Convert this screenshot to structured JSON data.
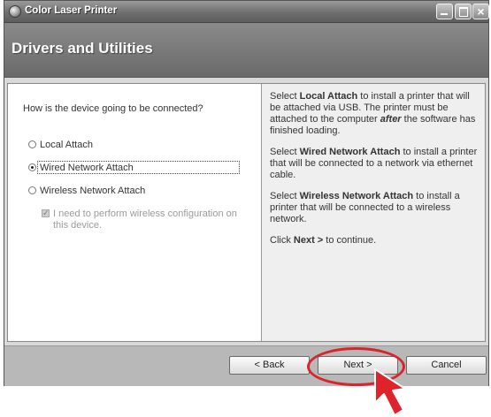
{
  "window": {
    "title": "Color Laser Printer"
  },
  "header": {
    "title": "Drivers and Utilities"
  },
  "left": {
    "question": "How is the device going to be connected?",
    "options": [
      {
        "label": "Local Attach",
        "checked": false
      },
      {
        "label": "Wired Network Attach",
        "checked": true
      },
      {
        "label": "Wireless Network Attach",
        "checked": false
      }
    ],
    "wireless_config": {
      "label": "I need to perform wireless configuration on this device.",
      "checked": true,
      "disabled": true
    }
  },
  "right": {
    "p1": {
      "pre": "Select ",
      "bold": "Local Attach",
      "mid": " to install a printer that will be attached via USB. The printer must be attached to the computer ",
      "em": "after",
      "post": " the software has finished loading."
    },
    "p2": {
      "pre": "Select ",
      "bold": "Wired Network Attach",
      "post": " to install a printer that will be connected to a network via ethernet cable."
    },
    "p3": {
      "pre": "Select ",
      "bold": "Wireless Network Attach",
      "post": " to install a printer that will be connected to a wireless network."
    },
    "p4": {
      "pre": "Click ",
      "bold": "Next >",
      "post": " to continue."
    }
  },
  "buttons": {
    "back": "< Back",
    "next": "Next >",
    "cancel": "Cancel"
  },
  "colors": {
    "annotation": "#d8242a",
    "header_band": "#7a7a7a"
  }
}
